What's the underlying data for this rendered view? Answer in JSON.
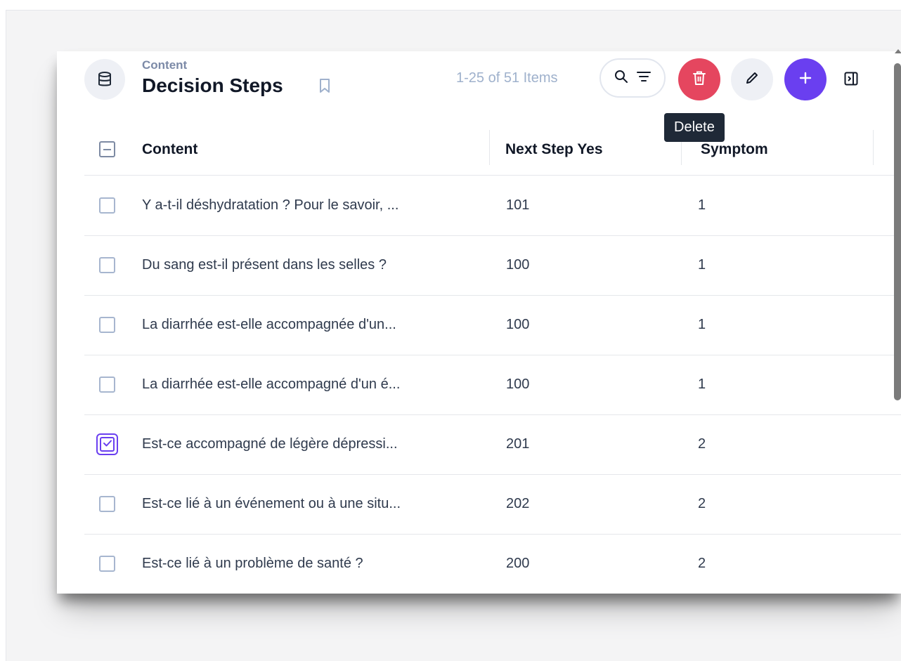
{
  "header": {
    "subtitle": "Content",
    "title": "Decision Steps",
    "item_count": "1-25 of 51 Items"
  },
  "tooltip": {
    "text": "Delete"
  },
  "colors": {
    "accent": "#6a3ff0",
    "danger": "#e5465f",
    "muted": "#9fb1cc"
  },
  "icons": {
    "database": "database-icon",
    "bookmark": "bookmark-icon",
    "search": "search-icon",
    "filter": "filter-icon",
    "trash": "trash-icon",
    "pencil": "pencil-icon",
    "plus": "plus-icon",
    "panel": "panel-toggle-icon"
  },
  "table": {
    "columns": [
      "Content",
      "Next Step Yes",
      "Symptom"
    ],
    "rows": [
      {
        "content": "Y a-t-il déshydratation ? Pour le savoir, ...",
        "next_step_yes": "101",
        "symptom": "1",
        "checked": false
      },
      {
        "content": "Du sang est-il présent dans les selles ?",
        "next_step_yes": "100",
        "symptom": "1",
        "checked": false
      },
      {
        "content": "La diarrhée est-elle accompagnée d'un...",
        "next_step_yes": "100",
        "symptom": "1",
        "checked": false
      },
      {
        "content": "La diarrhée est-elle accompagné d'un é...",
        "next_step_yes": "100",
        "symptom": "1",
        "checked": false
      },
      {
        "content": "Est-ce accompagné de légère dépressi...",
        "next_step_yes": "201",
        "symptom": "2",
        "checked": true
      },
      {
        "content": "Est-ce lié à un événement ou à une situ...",
        "next_step_yes": "202",
        "symptom": "2",
        "checked": false
      },
      {
        "content": "Est-ce lié à un problème de santé ?",
        "next_step_yes": "200",
        "symptom": "2",
        "checked": false
      }
    ]
  }
}
